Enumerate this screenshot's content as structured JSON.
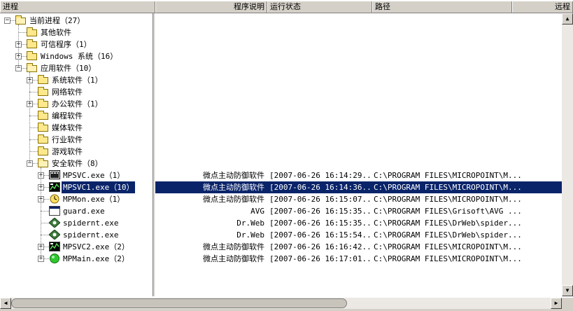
{
  "columns": [
    {
      "label": "进程"
    },
    {
      "label": "程序说明"
    },
    {
      "label": "运行状态"
    },
    {
      "label": "路径"
    },
    {
      "label": "远程"
    }
  ],
  "tree": [
    {
      "label": "当前进程（27）",
      "icon": "folder-open-icon",
      "expander": "−"
    },
    {
      "label": "其他软件",
      "icon": "folder-icon",
      "expander": ""
    },
    {
      "label": "可信程序（1）",
      "icon": "folder-icon",
      "expander": "+"
    },
    {
      "label": "Windows 系统（16）",
      "icon": "folder-icon",
      "expander": "+"
    },
    {
      "label": "应用软件（10）",
      "icon": "folder-open-icon",
      "expander": "−"
    },
    {
      "label": "系统软件（1）",
      "icon": "folder-icon",
      "expander": "+"
    },
    {
      "label": "网络软件",
      "icon": "folder-icon",
      "expander": ""
    },
    {
      "label": "办公软件（1）",
      "icon": "folder-icon",
      "expander": "+"
    },
    {
      "label": "编程软件",
      "icon": "folder-icon",
      "expander": ""
    },
    {
      "label": "媒体软件",
      "icon": "folder-icon",
      "expander": ""
    },
    {
      "label": "行业软件",
      "icon": "folder-icon",
      "expander": ""
    },
    {
      "label": "游戏软件",
      "icon": "folder-icon",
      "expander": ""
    },
    {
      "label": "安全软件（8）",
      "icon": "folder-open-icon",
      "expander": "−"
    },
    {
      "label": "MPSVC.exe（1）",
      "icon": "monitor-process-icon",
      "expander": "+"
    },
    {
      "label": "MPSVC1.exe（10）",
      "icon": "chart-process-icon",
      "expander": "+"
    },
    {
      "label": "MPMon.exe（1）",
      "icon": "clock-process-icon",
      "expander": "+"
    },
    {
      "label": "guard.exe",
      "icon": "window-app-icon",
      "expander": ""
    },
    {
      "label": "spidernt.exe",
      "icon": "spider-icon",
      "expander": ""
    },
    {
      "label": "spidernt.exe",
      "icon": "spider-icon",
      "expander": ""
    },
    {
      "label": "MPSVC2.exe（2）",
      "icon": "chart-process-icon",
      "expander": "+"
    },
    {
      "label": "MPMain.exe（2）",
      "icon": "green-circle-icon",
      "expander": "+"
    }
  ],
  "rows": [
    {
      "desc": "微点主动防御软件",
      "status": "[2007-06-26 16:14:29...",
      "path": "C:\\PROGRAM FILES\\MICROPOINT\\M..."
    },
    {
      "desc": "微点主动防御软件",
      "status": "[2007-06-26 16:14:36...",
      "path": "C:\\PROGRAM FILES\\MICROPOINT\\M..."
    },
    {
      "desc": "微点主动防御软件",
      "status": "[2007-06-26 16:15:07...",
      "path": "C:\\PROGRAM FILES\\MICROPOINT\\M..."
    },
    {
      "desc": "AVG",
      "status": "[2007-06-26 16:15:35...",
      "path": "C:\\PROGRAM FILES\\Grisoft\\AVG ..."
    },
    {
      "desc": "Dr.Web",
      "status": "[2007-06-26 16:15:35...",
      "path": "C:\\PROGRAM FILES\\DrWeb\\spider..."
    },
    {
      "desc": "Dr.Web",
      "status": "[2007-06-26 16:15:54...",
      "path": "C:\\PROGRAM FILES\\DrWeb\\spider..."
    },
    {
      "desc": "微点主动防御软件",
      "status": "[2007-06-26 16:16:42...",
      "path": "C:\\PROGRAM FILES\\MICROPOINT\\M..."
    },
    {
      "desc": "微点主动防御软件",
      "status": "[2007-06-26 16:17:01...",
      "path": "C:\\PROGRAM FILES\\MICROPOINT\\M..."
    }
  ],
  "selected_row": 1,
  "colors": {
    "selection": "#0a246a",
    "chrome": "#d4d0c8"
  }
}
